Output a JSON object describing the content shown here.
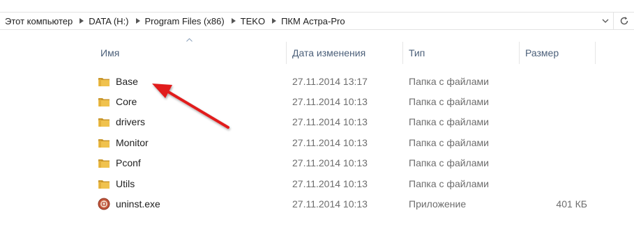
{
  "address": {
    "crumbs": [
      "Этот компьютер",
      "DATA (H:)",
      "Program Files (x86)",
      "TEKO",
      "ПКМ Астра-Pro"
    ]
  },
  "columns": {
    "name": "Имя",
    "date": "Дата изменения",
    "type": "Тип",
    "size": "Размер"
  },
  "files": [
    {
      "name": "Base",
      "date": "27.11.2014 13:17",
      "type": "Папка с файлами",
      "size": "",
      "icon": "folder-icon"
    },
    {
      "name": "Core",
      "date": "27.11.2014 10:13",
      "type": "Папка с файлами",
      "size": "",
      "icon": "folder-icon"
    },
    {
      "name": "drivers",
      "date": "27.11.2014 10:13",
      "type": "Папка с файлами",
      "size": "",
      "icon": "folder-icon"
    },
    {
      "name": "Monitor",
      "date": "27.11.2014 10:13",
      "type": "Папка с файлами",
      "size": "",
      "icon": "folder-icon"
    },
    {
      "name": "Pconf",
      "date": "27.11.2014 10:13",
      "type": "Папка с файлами",
      "size": "",
      "icon": "folder-icon"
    },
    {
      "name": "Utils",
      "date": "27.11.2014 10:13",
      "type": "Папка с файлами",
      "size": "",
      "icon": "folder-icon"
    },
    {
      "name": "uninst.exe",
      "date": "27.11.2014 10:13",
      "type": "Приложение",
      "size": "401 КБ",
      "icon": "uninstaller-icon"
    }
  ],
  "colors": {
    "header_text": "#4c607a",
    "annotation_arrow": "#e11d1d",
    "folder": "#e7b43d"
  }
}
